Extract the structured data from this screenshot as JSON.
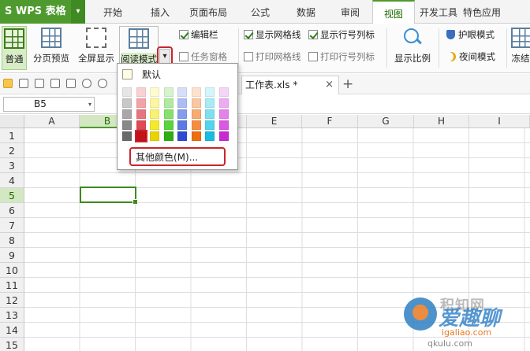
{
  "app": {
    "logo_text": "S WPS 表格",
    "logo_dropdown": "▾"
  },
  "menu": {
    "tabs": [
      "开始",
      "插入",
      "页面布局",
      "公式",
      "数据",
      "审阅",
      "视图",
      "开发工具",
      "特色应用"
    ],
    "active_tab": "视图"
  },
  "ribbon": {
    "normal_label": "普通",
    "page_break_label": "分页预览",
    "fullscreen_label": "全屏显示",
    "reading_mode_label": "阅读模式",
    "reading_mode_dropdown": "▾",
    "editbar_label": "编辑栏",
    "task_pane_label": "任务窗格",
    "show_gridlines_label": "显示网格线",
    "print_gridlines_label": "打印网格线",
    "show_rowcol_label": "显示行号列标",
    "print_rowcol_label": "打印行号列标",
    "zoom_label": "显示比例",
    "eye_mode_label": "护眼模式",
    "night_mode_label": "夜间模式",
    "freeze_label": "冻结"
  },
  "checkbox_states": {
    "editbar": true,
    "task_pane": false,
    "show_gridlines": true,
    "print_gridlines": false,
    "show_rowcol": true,
    "print_rowcol": false
  },
  "document": {
    "tab_title": "工作表.xls *",
    "close": "×",
    "new_tab": "+"
  },
  "formula_bar": {
    "cell_ref": "B5",
    "dropdown": "▾"
  },
  "sheet": {
    "columns": [
      "A",
      "B",
      "C",
      "D",
      "E",
      "F",
      "G",
      "H",
      "I"
    ],
    "rows": [
      "1",
      "2",
      "3",
      "4",
      "5",
      "6",
      "7",
      "8",
      "9",
      "10",
      "11",
      "12",
      "13",
      "14",
      "15"
    ],
    "active_column": "B",
    "active_row": "5"
  },
  "color_menu": {
    "default_label": "默认",
    "more_colors_label": "其他颜色(M)...",
    "palette": [
      [
        "#e6e6e6",
        "#c8c8c8",
        "#a8a8a8",
        "#888888",
        "#6a6a6a"
      ],
      [
        "#f9d1d3",
        "#f2a3a8",
        "#e8757d",
        "#e04a55",
        "#c4121a"
      ],
      [
        "#fdfbd0",
        "#fbf7a0",
        "#f8f26e",
        "#f3ea2c",
        "#e9d400"
      ],
      [
        "#d5f4cc",
        "#aeeb9e",
        "#85e06d",
        "#5ad43c",
        "#2eae12"
      ],
      [
        "#d6defa",
        "#adbdf3",
        "#849ceb",
        "#5a7be3",
        "#2f4ad0"
      ],
      [
        "#fde3cf",
        "#fbc7a0",
        "#f8aa70",
        "#f58d40",
        "#ee6e10"
      ],
      [
        "#d3f5fb",
        "#a8ebf6",
        "#7ce0f1",
        "#50d5ec",
        "#16bde0"
      ],
      [
        "#f6d6f8",
        "#edacf1",
        "#e383ea",
        "#d959e3",
        "#c52ad3"
      ]
    ],
    "picked": [
      1,
      4
    ]
  },
  "watermark": {
    "top": "积知网",
    "big": "爱趣聊",
    "url": "igaliao.com",
    "url2": "qkulu.com"
  },
  "colors": {
    "accent": "#4e9a2e",
    "highlight": "#c9252b"
  }
}
